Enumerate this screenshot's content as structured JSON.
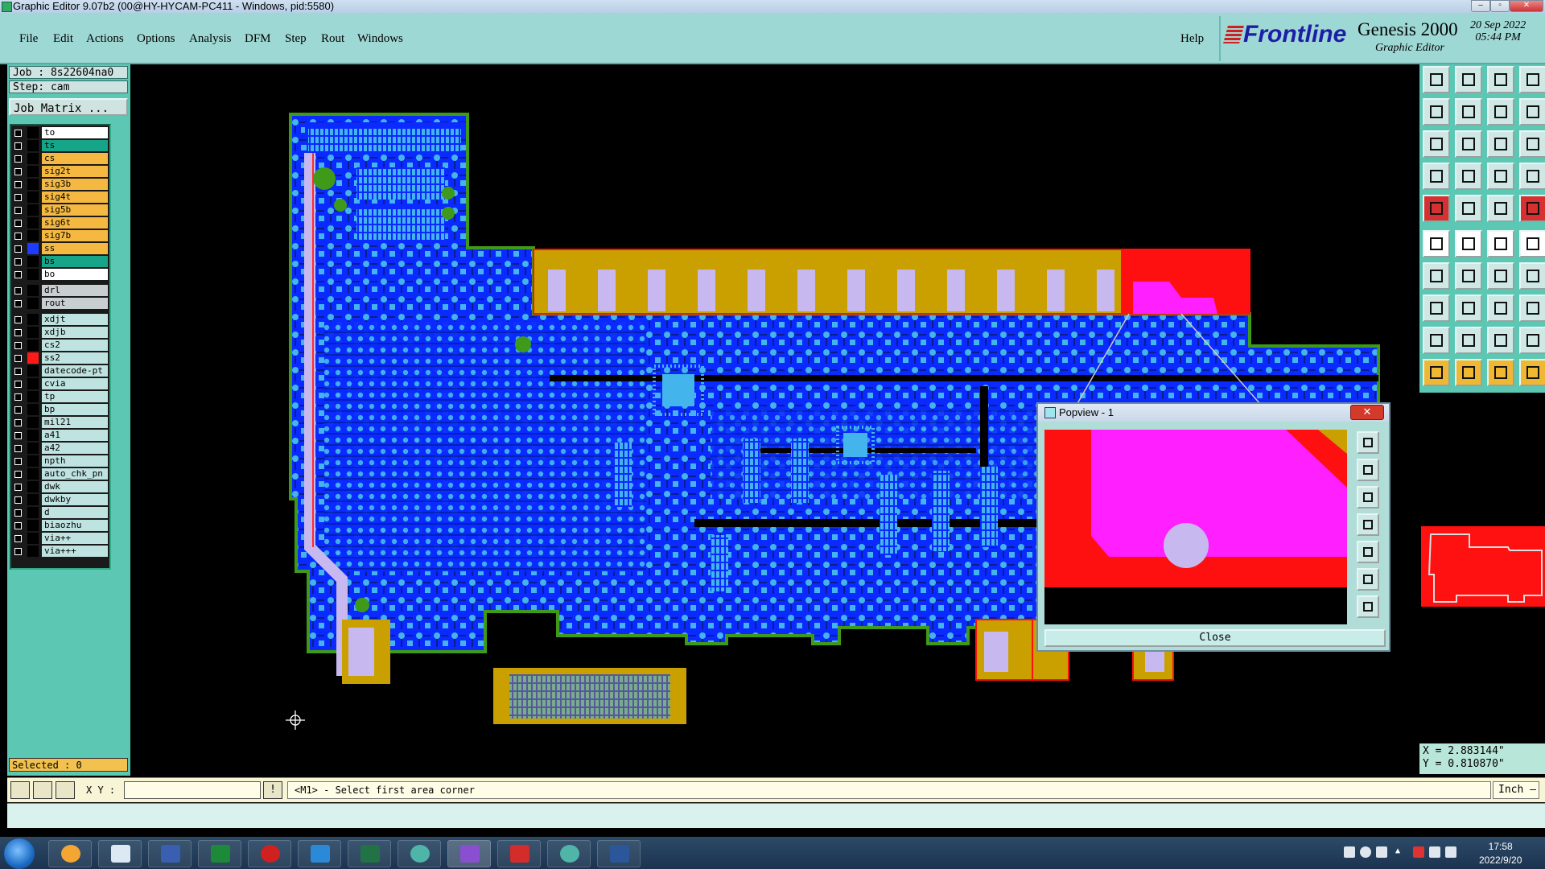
{
  "window": {
    "title": "Graphic Editor 9.07b2 (00@HY-HYCAM-PC411 - Windows, pid:5580)"
  },
  "menu": {
    "file": "File",
    "edit": "Edit",
    "actions": "Actions",
    "options": "Options",
    "analysis": "Analysis",
    "dfm": "DFM",
    "step": "Step",
    "rout": "Rout",
    "windows": "Windows",
    "help": "Help"
  },
  "brand": {
    "logo": "Frontline",
    "product": "Genesis 2000",
    "subtitle": "Graphic Editor",
    "date": "20 Sep 2022",
    "time": "05:44 PM"
  },
  "job": {
    "job_label": "Job : 8s22604na0",
    "step_label": "Step: cam",
    "matrix_button": "Job Matrix ..."
  },
  "layers": [
    {
      "name": "to",
      "color": "#ffffff"
    },
    {
      "name": "ts",
      "color": "#17a589"
    },
    {
      "name": "cs",
      "color": "#f5b942"
    },
    {
      "name": "sig2t",
      "color": "#f5b942"
    },
    {
      "name": "sig3b",
      "color": "#f5b942"
    },
    {
      "name": "sig4t",
      "color": "#f5b942"
    },
    {
      "name": "sig5b",
      "color": "#f5b942"
    },
    {
      "name": "sig6t",
      "color": "#f5b942"
    },
    {
      "name": "sig7b",
      "color": "#f5b942"
    },
    {
      "name": "ss",
      "color": "#f5b942",
      "swatch": "#1f3bff"
    },
    {
      "name": "bs",
      "color": "#17a589"
    },
    {
      "name": "bo",
      "color": "#ffffff"
    },
    {
      "name": "drl",
      "color": "#c9cfd0"
    },
    {
      "name": "rout",
      "color": "#c9cfd0"
    },
    {
      "name": "xdjt",
      "color": "#bfe3e0"
    },
    {
      "name": "xdjb",
      "color": "#bfe3e0"
    },
    {
      "name": "cs2",
      "color": "#bfe3e0"
    },
    {
      "name": "ss2",
      "color": "#bfe3e0",
      "swatch": "#ff1a1a"
    },
    {
      "name": "datecode-pt",
      "color": "#bfe3e0"
    },
    {
      "name": "cvia",
      "color": "#bfe3e0"
    },
    {
      "name": "tp",
      "color": "#bfe3e0"
    },
    {
      "name": "bp",
      "color": "#bfe3e0"
    },
    {
      "name": "mil21",
      "color": "#bfe3e0"
    },
    {
      "name": "a41",
      "color": "#bfe3e0"
    },
    {
      "name": "a42",
      "color": "#bfe3e0"
    },
    {
      "name": "npth",
      "color": "#bfe3e0"
    },
    {
      "name": "auto_chk_pn",
      "color": "#bfe3e0"
    },
    {
      "name": "dwk",
      "color": "#bfe3e0"
    },
    {
      "name": "dwkby",
      "color": "#bfe3e0"
    },
    {
      "name": "d",
      "color": "#bfe3e0"
    },
    {
      "name": "biaozhu",
      "color": "#bfe3e0"
    },
    {
      "name": "via++",
      "color": "#bfe3e0"
    },
    {
      "name": "via+++",
      "color": "#bfe3e0"
    }
  ],
  "status": {
    "selected": "Selected : 0",
    "xy_label": "X Y :",
    "prompt": "<M1> - Select first area corner",
    "unit": "Inch –"
  },
  "coords": {
    "x": "X = 2.883144\"",
    "y": "Y = 0.810870\""
  },
  "popview": {
    "title": "Popview - 1",
    "close_label": "Close"
  },
  "taskbar": {
    "time": "17:58",
    "date": "2022/9/20"
  },
  "colors": {
    "board_fill": "#0a2aff",
    "gold": "#c9a000",
    "pad": "#43b4ec",
    "outline": "#3f9a1a",
    "highlight": "#ff1010",
    "magenta": "#ff1fff",
    "panel": "#5cc8b4"
  }
}
